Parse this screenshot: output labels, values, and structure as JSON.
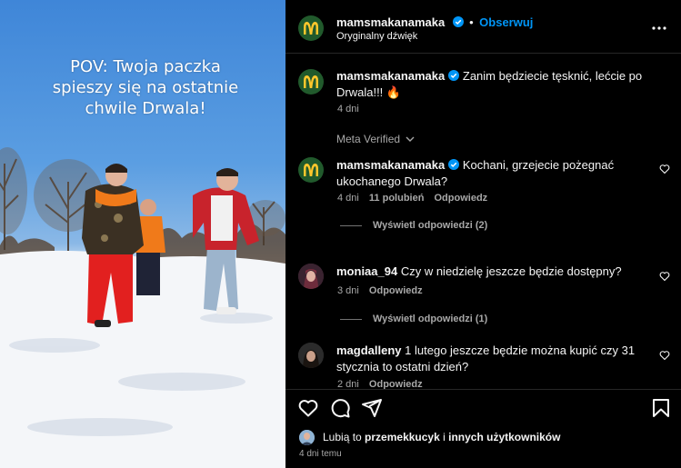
{
  "post": {
    "overlay_text": "POV: Twoja paczka\nspieszy się na ostatnie\nchwile Drwala!",
    "username": "mamsmakanamaka",
    "follow_label": "Obserwuj",
    "separator": "•",
    "audio": "Oryginalny dźwięk"
  },
  "caption": {
    "username": "mamsmakanamaka",
    "text_line1": "Zanim będziecie tęsknić, lećcie po",
    "text_line2": "Drwala!!! 🔥",
    "time": "4 dni"
  },
  "meta_verified": "Meta Verified",
  "comments": [
    {
      "username": "mamsmakanamaka",
      "text_line1": "Kochani, grzejecie pożegnać",
      "text_line2": "ukochanego Drwala?",
      "time": "4 dni",
      "likes": "11 polubień",
      "reply": "Odpowiedz",
      "view_replies": "Wyświetl odpowiedzi (2)"
    },
    {
      "username": "moniaa_94",
      "text_line1": "Czy w niedzielę jeszcze będzie dostępny?",
      "time": "3 dni",
      "reply": "Odpowiedz",
      "view_replies": "Wyświetl odpowiedzi (1)"
    },
    {
      "username": "magdalleny",
      "text_line1": "1 lutego jeszcze będzie można kupić czy 31",
      "text_line2": "stycznia to ostatni dzień?",
      "time": "2 dni",
      "reply": "Odpowiedz"
    }
  ],
  "footer": {
    "likes_prefix": "Lubią to ",
    "likes_user": "przemekkucyk",
    "likes_mid": " i ",
    "likes_others": "innych użytkowników",
    "time": "4 dni temu"
  },
  "colors": {
    "accent": "#0095f6",
    "verified": "#0095f6",
    "mc_green": "#215a2c",
    "mc_yellow": "#ffc72c"
  }
}
